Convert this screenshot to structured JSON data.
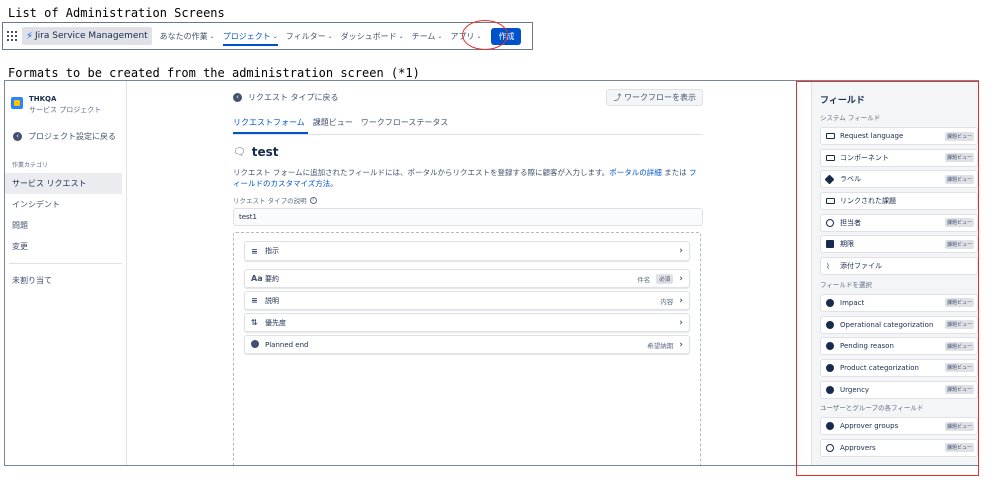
{
  "captions": {
    "list_title": "List of Administration Screens",
    "formats_title": "Formats to be created from the administration screen (*1)"
  },
  "topnav": {
    "brand": "Jira Service Management",
    "items": [
      {
        "label": "あなたの作業"
      },
      {
        "label": "プロジェクト"
      },
      {
        "label": "フィルター"
      },
      {
        "label": "ダッシュボード"
      },
      {
        "label": "チーム"
      },
      {
        "label": "アプリ"
      }
    ],
    "create_label": "作成"
  },
  "sidebar": {
    "project_name": "THKQA",
    "project_type": "サービス プロジェクト",
    "back_label": "プロジェクト設定に戻る",
    "category_heading": "作業カテゴリ",
    "items": [
      {
        "label": "サービス リクエスト"
      },
      {
        "label": "インシデント"
      },
      {
        "label": "問題"
      },
      {
        "label": "変更"
      }
    ],
    "unassigned_label": "未割り当て"
  },
  "main": {
    "back_label": "リクエスト タイプに戻る",
    "workflow_button": "ワークフローを表示",
    "tabs": [
      {
        "label": "リクエストフォーム"
      },
      {
        "label": "課題ビュー"
      },
      {
        "label": "ワークフローステータス"
      }
    ],
    "title": "test",
    "description_prefix": "リクエスト フォームに追加されたフィールドには、ポータルからリクエストを登録する際に顧客が入力します。",
    "description_link1": "ポータルの詳細",
    "description_mid": " または ",
    "description_link2": "フィールドのカスタマイズ方法",
    "description_suffix": "。",
    "field_label": "リクエスト タイプの説明",
    "field_value": "test1",
    "form_fields": [
      {
        "icon": "≡",
        "label": "指示",
        "alias": "",
        "required": ""
      },
      {
        "icon": "Aa",
        "label": "要約",
        "alias": "件名",
        "required": "必須"
      },
      {
        "icon": "≡",
        "label": "説明",
        "alias": "内容",
        "required": ""
      },
      {
        "icon": "⇅",
        "label": "優先度",
        "alias": "",
        "required": ""
      },
      {
        "icon": "clock",
        "label": "Planned end",
        "alias": "希望納期",
        "required": ""
      }
    ]
  },
  "panel": {
    "title": "フィールド",
    "system_heading": "システム フィールド",
    "system_fields": [
      {
        "icon": "folder",
        "label": "Request language",
        "badge": "課題ビュー"
      },
      {
        "icon": "folder",
        "label": "コンポーネント",
        "badge": "課題ビュー"
      },
      {
        "icon": "tag",
        "label": "ラベル",
        "badge": "課題ビュー"
      },
      {
        "icon": "folder",
        "label": "リンクされた課題",
        "badge": ""
      },
      {
        "icon": "ring",
        "label": "担当者",
        "badge": "課題ビュー"
      },
      {
        "icon": "calendar",
        "label": "期限",
        "badge": "課題ビュー"
      },
      {
        "icon": "clip",
        "label": "添付ファイル",
        "badge": ""
      }
    ],
    "select_heading": "フィールドを選択",
    "select_fields": [
      {
        "icon": "dot",
        "label": "Impact",
        "badge": "課題ビュー"
      },
      {
        "icon": "dot",
        "label": "Operational categorization",
        "badge": "課題ビュー"
      },
      {
        "icon": "dot",
        "label": "Pending reason",
        "badge": "課題ビュー"
      },
      {
        "icon": "dot",
        "label": "Product categorization",
        "badge": "課題ビュー"
      },
      {
        "icon": "dot",
        "label": "Urgency",
        "badge": "課題ビュー"
      }
    ],
    "user_heading": "ユーザーとグループの各フィールド",
    "user_fields": [
      {
        "icon": "dot",
        "label": "Approver groups",
        "badge": "課題ビュー"
      },
      {
        "icon": "ring",
        "label": "Approvers",
        "badge": "課題ビュー"
      }
    ]
  },
  "colors": {
    "accent": "#0052cc",
    "annotation_red": "#e03131"
  }
}
